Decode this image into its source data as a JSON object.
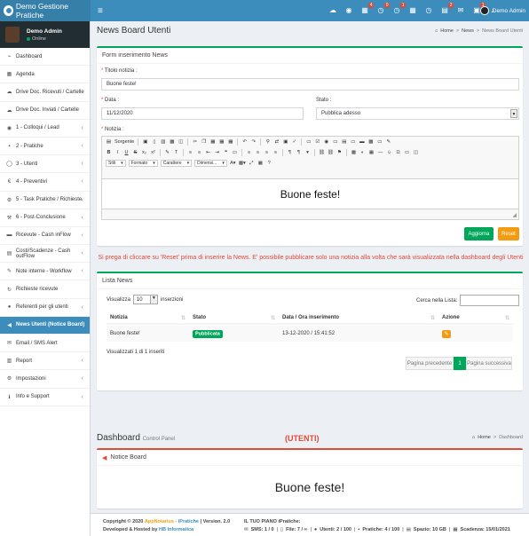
{
  "app": {
    "title": "Demo Gestione Pratiche"
  },
  "topbar": {
    "icons": [
      {
        "name": "cloud-icon",
        "glyph": "☁",
        "badge": ""
      },
      {
        "name": "eye-icon",
        "glyph": "◉",
        "badge": ""
      },
      {
        "name": "calendar-icon",
        "glyph": "▦",
        "badge": "4"
      },
      {
        "name": "clock-icon",
        "glyph": "◷",
        "badge": "0"
      },
      {
        "name": "alarm-icon",
        "glyph": "◷",
        "badge": "1"
      },
      {
        "name": "calendar-check-icon",
        "glyph": "▦",
        "badge": ""
      },
      {
        "name": "clock-alt-icon",
        "glyph": "◷",
        "badge": ""
      },
      {
        "name": "chart-icon",
        "glyph": "▤",
        "badge": "2"
      },
      {
        "name": "envelope-icon",
        "glyph": "✉",
        "badge": ""
      },
      {
        "name": "inbox-icon",
        "glyph": "▣",
        "badge": "1"
      },
      {
        "name": "bell-icon",
        "glyph": "♪",
        "badge": ""
      }
    ],
    "user_name": "Demo Admin"
  },
  "sidebar": {
    "user": {
      "name": "Demo Admin",
      "status": "Online"
    },
    "items": [
      {
        "label": "Dashboard",
        "icon": "dashboard-icon",
        "glyph": "⌁",
        "chev": false,
        "active": false
      },
      {
        "label": "Agenda",
        "icon": "calendar-icon",
        "glyph": "▦",
        "chev": false,
        "active": false
      },
      {
        "label": "Drive Doc. Ricevuti / Cartelle",
        "icon": "cloud-download-icon",
        "glyph": "☁",
        "chev": false,
        "active": false
      },
      {
        "label": "Drive Doc. Inviati / Cartelle",
        "icon": "cloud-upload-icon",
        "glyph": "☁",
        "chev": false,
        "active": false
      },
      {
        "label": "1 - Colloqui / Lead",
        "icon": "eye-icon",
        "glyph": "◉",
        "chev": true,
        "active": false
      },
      {
        "label": "2 - Pratiche",
        "icon": "folder-icon",
        "glyph": "▪",
        "chev": true,
        "active": false
      },
      {
        "label": "3 - Utenti",
        "icon": "user-icon",
        "glyph": "◯",
        "chev": true,
        "active": false
      },
      {
        "label": "4 - Preventivi",
        "icon": "euro-icon",
        "glyph": "€",
        "chev": true,
        "active": false
      },
      {
        "label": "5 - Task Pratiche / Richieste",
        "icon": "cogs-icon",
        "glyph": "⚙",
        "chev": true,
        "active": false
      },
      {
        "label": "6 - Post-Conclusione",
        "icon": "gavel-icon",
        "glyph": "⚒",
        "chev": true,
        "active": false
      },
      {
        "label": "Ricevute - Cash inFlow",
        "icon": "money-icon",
        "glyph": "▬",
        "chev": true,
        "active": false
      },
      {
        "label": "Costi/Scadenze - Cash outFlow",
        "icon": "calculator-icon",
        "glyph": "▤",
        "chev": true,
        "active": false
      },
      {
        "label": "Note interne - Workflow",
        "icon": "sticky-note-icon",
        "glyph": "✎",
        "chev": true,
        "active": false
      },
      {
        "label": "Richieste ricevute",
        "icon": "refresh-icon",
        "glyph": "↻",
        "chev": false,
        "active": false
      },
      {
        "label": "Referenti per gli utenti",
        "icon": "user-icon",
        "glyph": "●",
        "chev": true,
        "active": false
      },
      {
        "label": "News Utenti (Notice Board)",
        "icon": "megaphone-icon",
        "glyph": "◀",
        "chev": false,
        "active": true
      },
      {
        "label": "Email / SMS Alert",
        "icon": "envelope-icon",
        "glyph": "✉",
        "chev": false,
        "active": false
      },
      {
        "label": "Report",
        "icon": "bar-chart-icon",
        "glyph": "▥",
        "chev": true,
        "active": false
      },
      {
        "label": "Impostazioni",
        "icon": "gear-icon",
        "glyph": "⚙",
        "chev": true,
        "active": false
      },
      {
        "label": "Info e Support",
        "icon": "info-icon",
        "glyph": "ℹ",
        "chev": true,
        "active": false
      }
    ]
  },
  "page": {
    "title": "News Board Utenti",
    "breadcrumb": {
      "home": "Home",
      "b1": "News",
      "b2": "News Board Utenti"
    }
  },
  "form": {
    "header": "Form inserimento News",
    "title_label": "Titolo notizia :",
    "title_value": "Buone feste!",
    "date_label": "Data :",
    "date_value": "11/12/2020",
    "state_label": "Stato :",
    "state_value": "Pubblica adesso",
    "news_label": "Notizia :",
    "editor": {
      "source_label": "Sorgente",
      "style_combo": "Stili",
      "format_combo": "Formato",
      "font_combo": "Carattere",
      "size_combo": "Dimensi...",
      "content": "Buone feste!"
    },
    "save_label": "Aggiorna",
    "reset_label": "Reset"
  },
  "warning": "Si prega di cliccare su 'Reset' prima di inserire la News. E' possibile pubblicare solo una notizia alla volta che sarà visualizzata nella dashboard degli Utenti",
  "list": {
    "header": "Lista News",
    "show_label": "Visualizza",
    "show_value": "10",
    "entries_label": "inserzioni",
    "search_label": "Cerca nella Lista:",
    "columns": [
      "Notizia",
      "Stato",
      "Data / Ora inserimento",
      "Azione"
    ],
    "rows": [
      {
        "notizia": "Buone feste!",
        "stato": "Pubblicata",
        "data": "13-12-2020 / 15:41:52"
      }
    ],
    "info": "Visualizzati 1 di 1 inseriti",
    "prev": "Pagina precedente",
    "page": "1",
    "next": "Pagina successiva"
  },
  "dashboard": {
    "title": "Dashboard",
    "subtitle": "Control Panel",
    "utenti": "(UTENTI)",
    "breadcrumb_home": "Home",
    "breadcrumb_current": "Dashboard",
    "notice_header": "Notice Board",
    "notice_text": "Buone feste!"
  },
  "footer": {
    "copyright_pre": "Copyright © 2020",
    "brand_app": "App",
    "brand_notarius": "Notarius",
    "brand_ipratiche": " - iPratiche",
    "version": "| Version. 2.0",
    "developed": "Developed & Hosted by",
    "hb": "HB Informatica",
    "plan_title": "IL TUO PIANO iPratiche:",
    "sms": "SMS: 1 / 0",
    "file": "File: 7 / ∞",
    "utenti": "Utenti: 2 / 100",
    "pratiche": "Pratiche: 4 / 100",
    "spazio": "Spazio: 10 GB",
    "scadenza": "Scadenza: 15/01/2021"
  },
  "colors": {
    "primary": "#3c8dbc",
    "success": "#00a65a",
    "warning": "#f39c12",
    "danger": "#dd4b39"
  }
}
